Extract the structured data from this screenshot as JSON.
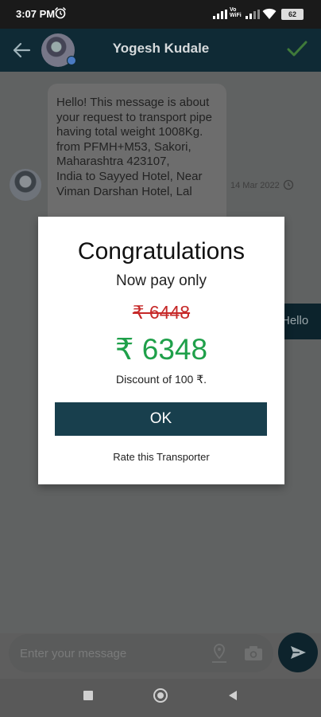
{
  "status_bar": {
    "time": "3:07 PM",
    "network_label_1": "Vo",
    "network_label_2": "WiFi",
    "battery": "62"
  },
  "header": {
    "contact_name": "Yogesh Kudale",
    "icons": [
      "back-arrow-icon",
      "avatar",
      "checkmark-icon"
    ]
  },
  "chat": {
    "incoming_message": "Hello! This message is about your request to transport pipe having total weight 1008Kg.\nfrom PFMH+M53, Sakori, Maharashtra 423107,\nIndia  to Sayyed Hotel, Near Viman Darshan Hotel, Lal",
    "incoming_time": "14 Mar 2022",
    "outgoing_message": "Hello"
  },
  "dialog": {
    "title": "Congratulations",
    "subtitle": "Now pay only",
    "old_price": "₹ 6448",
    "new_price": "₹ 6348",
    "discount_text": "Discount of 100 ₹.",
    "ok_label": "OK",
    "rate_label": "Rate this Transporter"
  },
  "input": {
    "placeholder": "Enter your message"
  },
  "colors": {
    "header_bg": "#0f2a35",
    "ok_button": "#183f4d",
    "old_price": "#c62828",
    "new_price": "#1fa04a"
  }
}
